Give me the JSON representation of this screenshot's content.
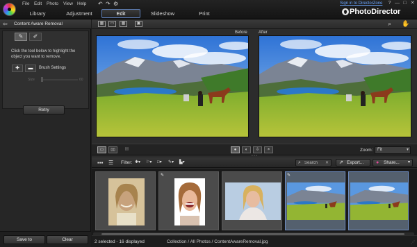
{
  "menu": [
    "File",
    "Edit",
    "Photo",
    "View",
    "Help"
  ],
  "main_tabs": [
    {
      "label": "Library"
    },
    {
      "label": "Adjustment"
    },
    {
      "label": "Edit",
      "active": true
    },
    {
      "label": "Slideshow"
    },
    {
      "label": "Print"
    }
  ],
  "signin_link": "Sign in to DirectorZone",
  "brand": "PhotoDirector",
  "window_controls": [
    "?",
    "—",
    "□",
    "✕"
  ],
  "left_panel": {
    "title": "Content Aware Removal",
    "description": "Click the tool below to highlight the object you want to remove.",
    "brush_settings_label": "Brush Settings",
    "size_label": "Size",
    "size_max": "60",
    "retry_label": "Retry",
    "save_label": "Save to",
    "clear_label": "Clear"
  },
  "viewer": {
    "before_label": "Before",
    "after_label": "After",
    "zoom_label": "Zoom:",
    "zoom_value": "Fit"
  },
  "filter_bar": {
    "filter_label": "Filter:",
    "search_placeholder": "Search",
    "export_label": "Export...",
    "share_label": "Share..."
  },
  "filmstrip": {
    "thumbnails": [
      {
        "kind": "woman-portrait-sepia",
        "edited": false,
        "selected": false
      },
      {
        "kind": "woman-portrait-laughing",
        "edited": true,
        "selected": false
      },
      {
        "kind": "woman-portrait-blonde",
        "edited": false,
        "selected": false
      },
      {
        "kind": "landscape-horse",
        "edited": true,
        "selected": true
      },
      {
        "kind": "landscape-horse",
        "edited": false,
        "selected": true
      }
    ]
  },
  "status": {
    "count": "2 selected - 16 displayed",
    "path": "Collection / All Photos / ContentAwareRemoval.jpg"
  },
  "colors": {
    "accent_blue": "#5e7fb8",
    "link_blue": "#6aa6ff",
    "panel_bg": "#262626"
  }
}
